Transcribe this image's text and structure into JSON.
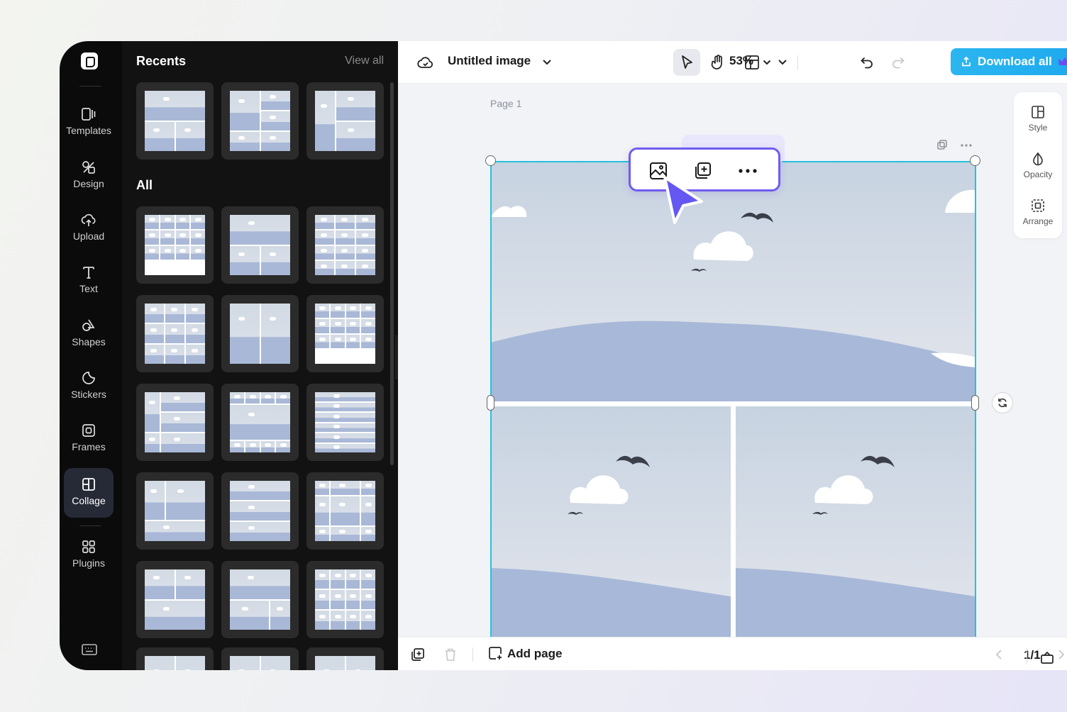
{
  "rail": {
    "items": [
      {
        "label": "Templates",
        "icon": "templates-icon"
      },
      {
        "label": "Design",
        "icon": "design-icon"
      },
      {
        "label": "Upload",
        "icon": "upload-icon"
      },
      {
        "label": "Text",
        "icon": "text-icon"
      },
      {
        "label": "Shapes",
        "icon": "shapes-icon"
      },
      {
        "label": "Stickers",
        "icon": "stickers-icon"
      },
      {
        "label": "Frames",
        "icon": "frames-icon"
      },
      {
        "label": "Collage",
        "icon": "collage-icon",
        "active": true
      },
      {
        "label": "Plugins",
        "icon": "plugins-icon"
      }
    ]
  },
  "panel": {
    "recents_title": "Recents",
    "view_all": "View all",
    "all_title": "All"
  },
  "topbar": {
    "title": "Untitled image",
    "zoom": "53%",
    "download_label": "Download all"
  },
  "canvas": {
    "page_label": "Page 1"
  },
  "props": {
    "style_label": "Style",
    "opacity_label": "Opacity",
    "arrange_label": "Arrange"
  },
  "bottombar": {
    "add_page_label": "Add page",
    "page_counter": "1/1"
  },
  "colors": {
    "accent": "#6f5cf0",
    "selection": "#27c0dc",
    "download": "#1ea9ee"
  }
}
